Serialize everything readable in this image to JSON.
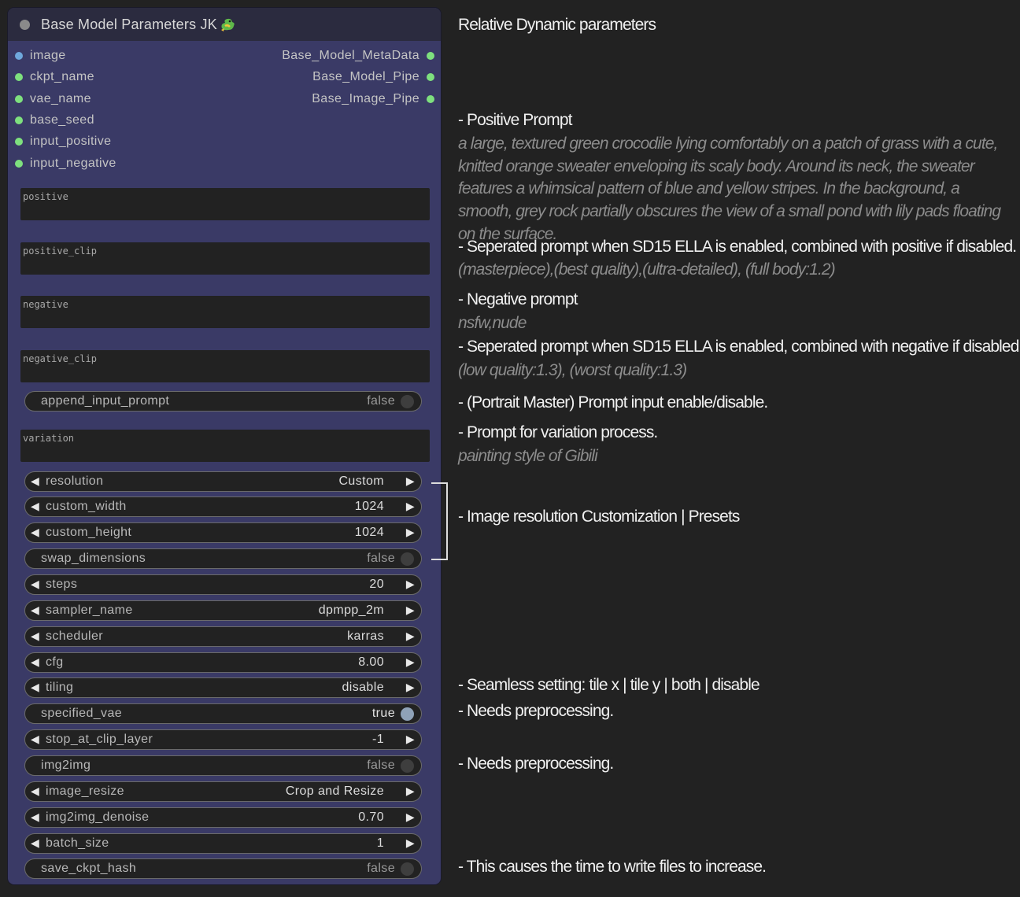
{
  "node": {
    "title": "Base Model Parameters JK",
    "inputs": [
      "image",
      "ckpt_name",
      "vae_name",
      "base_seed",
      "input_positive",
      "input_negative"
    ],
    "outputs": [
      "Base_Model_MetaData",
      "Base_Model_Pipe",
      "Base_Image_Pipe"
    ],
    "text_fields": {
      "positive": "positive",
      "positive_clip": "positive_clip",
      "negative": "negative",
      "negative_clip": "negative_clip",
      "variation": "variation"
    },
    "widgets": {
      "append_input_prompt": {
        "label": "append_input_prompt",
        "value": "false"
      },
      "resolution": {
        "label": "resolution",
        "value": "Custom"
      },
      "custom_width": {
        "label": "custom_width",
        "value": "1024"
      },
      "custom_height": {
        "label": "custom_height",
        "value": "1024"
      },
      "swap_dimensions": {
        "label": "swap_dimensions",
        "value": "false"
      },
      "steps": {
        "label": "steps",
        "value": "20"
      },
      "sampler_name": {
        "label": "sampler_name",
        "value": "dpmpp_2m"
      },
      "scheduler": {
        "label": "scheduler",
        "value": "karras"
      },
      "cfg": {
        "label": "cfg",
        "value": "8.00"
      },
      "tiling": {
        "label": "tiling",
        "value": "disable"
      },
      "specified_vae": {
        "label": "specified_vae",
        "value": "true"
      },
      "stop_at_clip_layer": {
        "label": "stop_at_clip_layer",
        "value": "-1"
      },
      "img2img": {
        "label": "img2img",
        "value": "false"
      },
      "image_resize": {
        "label": "image_resize",
        "value": "Crop and Resize"
      },
      "img2img_denoise": {
        "label": "img2img_denoise",
        "value": "0.70"
      },
      "batch_size": {
        "label": "batch_size",
        "value": "1"
      },
      "save_ckpt_hash": {
        "label": "save_ckpt_hash",
        "value": "false"
      }
    }
  },
  "annotations": {
    "heading": "Relative Dynamic parameters",
    "positive": "- Positive Prompt",
    "positive_example": "a large, textured green crocodile lying comfortably on a patch of grass with a cute, knitted orange sweater enveloping its scaly body. Around its neck, the sweater features a whimsical pattern of blue and yellow stripes. In the background, a smooth, grey rock partially obscures the view of a small pond with lily pads floating on the surface.",
    "positive_clip": "- Seperated prompt when SD15 ELLA is enabled, combined with positive if disabled.",
    "positive_clip_example": "(masterpiece),(best quality),(ultra-detailed), (full body:1.2)",
    "negative": "- Negative prompt",
    "negative_example": "nsfw,nude",
    "negative_clip": "- Seperated prompt when SD15 ELLA is enabled, combined with negative if disabled.",
    "negative_clip_example": "(low quality:1.3), (worst quality:1.3)",
    "append": "- (Portrait Master) Prompt input enable/disable.",
    "variation": "- Prompt for variation process.",
    "variation_example": "painting style of Gibili",
    "resolution": "- Image resolution Customization | Presets",
    "tiling": "- Seamless setting: tile x | tile y | both | disable",
    "specified_vae": "- Needs preprocessing.",
    "img2img": "- Needs preprocessing.",
    "save_hash": "- This causes the time to write files to increase."
  }
}
